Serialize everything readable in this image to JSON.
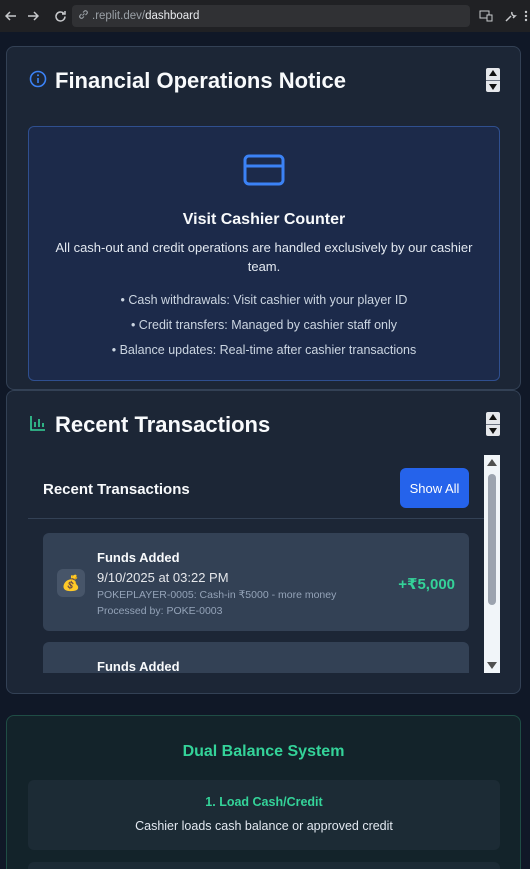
{
  "browser": {
    "url_prefix": ".replit.dev/",
    "url_path": "dashboard"
  },
  "notice": {
    "title": "Financial Operations Notice",
    "heading": "Visit Cashier Counter",
    "description": "All cash-out and credit operations are handled exclusively by our cashier team.",
    "bullets": [
      "• Cash withdrawals: Visit cashier with your player ID",
      "• Credit transfers: Managed by cashier staff only",
      "• Balance updates: Real-time after cashier transactions"
    ]
  },
  "transactions_section": {
    "title": "Recent Transactions",
    "panel_title": "Recent Transactions",
    "show_all_label": "Show All",
    "items": [
      {
        "icon": "money-bag-icon",
        "title": "Funds Added",
        "date": "9/10/2025 at 03:22 PM",
        "description": "POKEPLAYER-0005: Cash-in ₹5000 - more money",
        "processed_by": "Processed by: POKE-0003",
        "amount": "+₹5,000"
      },
      {
        "title": "Funds Added"
      }
    ]
  },
  "dual_balance": {
    "title": "Dual Balance System",
    "steps": [
      {
        "title": "1. Load Cash/Credit",
        "description": "Cashier loads cash balance or approved credit"
      }
    ]
  },
  "colors": {
    "accent_blue": "#2563eb",
    "accent_green": "#34d399",
    "card_bg": "#1c2636"
  }
}
